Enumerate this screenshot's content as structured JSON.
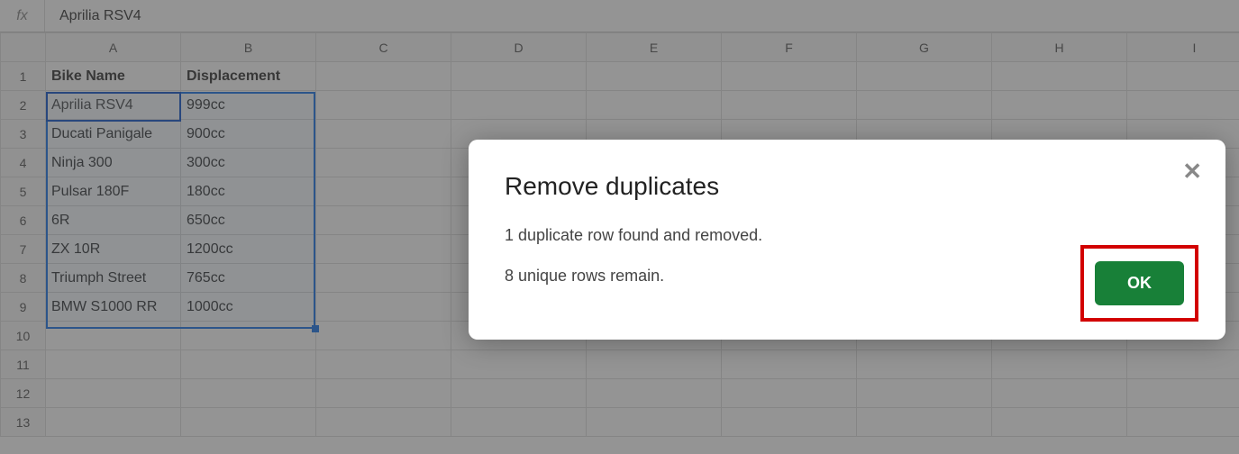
{
  "formula_bar": {
    "fx": "fx",
    "value": "Aprilia RSV4"
  },
  "columns": [
    "A",
    "B",
    "C",
    "D",
    "E",
    "F",
    "G",
    "H",
    "I"
  ],
  "row_numbers": [
    "1",
    "2",
    "3",
    "4",
    "5",
    "6",
    "7",
    "8",
    "9",
    "10",
    "11",
    "12",
    "13"
  ],
  "cells": {
    "A1": "Bike Name",
    "B1": "Displacement",
    "A2": "Aprilia RSV4",
    "B2": "999cc",
    "A3": "Ducati Panigale",
    "B3": "900cc",
    "A4": "Ninja 300",
    "B4": "300cc",
    "A5": "Pulsar 180F",
    "B5": "180cc",
    "A6": "6R",
    "B6": "650cc",
    "A7": "ZX 10R",
    "B7": "1200cc",
    "A8": "Triumph Street",
    "B8": "765cc",
    "A9": "BMW S1000 RR",
    "B9": "1000cc"
  },
  "dialog": {
    "title": "Remove duplicates",
    "line1": "1 duplicate row found and removed.",
    "line2": "8 unique rows remain.",
    "ok": "OK",
    "close": "✕"
  }
}
